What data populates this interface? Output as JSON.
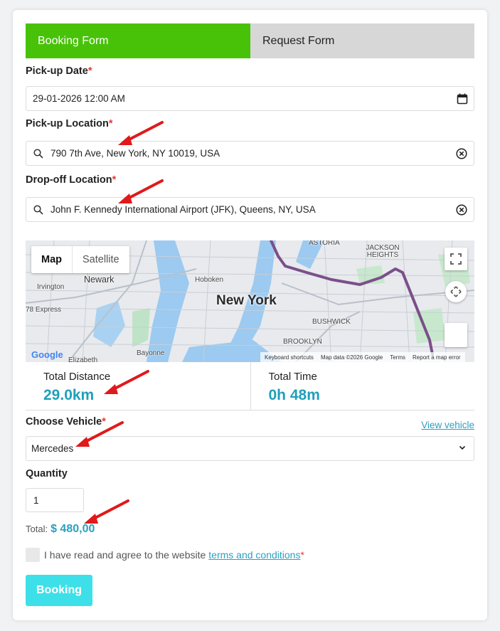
{
  "tabs": [
    {
      "label": "Booking Form",
      "active": true
    },
    {
      "label": "Request Form",
      "active": false
    }
  ],
  "pickup_date": {
    "label": "Pick-up Date",
    "required": "*",
    "value": "29-01-2026 12:00 AM",
    "icon": "calendar-icon"
  },
  "pickup_location": {
    "label": "Pick-up Location",
    "required": "*",
    "value": "790 7th Ave, New York, NY 10019, USA",
    "icons": [
      "search-icon",
      "clear-icon"
    ]
  },
  "dropoff_location": {
    "label": "Drop-off Location",
    "required": "*",
    "value": "John F. Kennedy International Airport (JFK), Queens, NY, USA",
    "icons": [
      "search-icon",
      "clear-icon"
    ]
  },
  "map": {
    "toggle": {
      "map": "Map",
      "satellite": "Satellite"
    },
    "city": "New York",
    "places": {
      "newark": "Newark",
      "hoboken": "Hoboken",
      "irvington": "Irvington",
      "bayonne": "Bayonne",
      "elizabeth": "Elizabeth",
      "brooklyn": "BROOKLYN",
      "bushwick": "BUSHWICK",
      "astoria": "ASTORIA",
      "jackson_heights": "JACKSON HEIGHTS",
      "express": "78 Express"
    },
    "footer": {
      "shortcuts": "Keyboard shortcuts",
      "data": "Map data ©2026 Google",
      "terms": "Terms",
      "report": "Report a map error"
    },
    "logo": "Google",
    "route_color": "#7b4f8a"
  },
  "total_distance": {
    "label": "Total Distance",
    "value": "29.0km"
  },
  "total_time": {
    "label": "Total Time",
    "value": "0h 48m"
  },
  "vehicle": {
    "label": "Choose Vehicle",
    "required": "*",
    "link": "View vehicle",
    "value": "Mercedes"
  },
  "quantity": {
    "label": "Quantity",
    "value": "1"
  },
  "total": {
    "label": "Total:",
    "value": "$ 480,00"
  },
  "agree": {
    "text": "I have read and agree to the website",
    "link": "terms and conditions",
    "required": "*"
  },
  "submit": {
    "label": "Booking"
  },
  "colors": {
    "tab_active": "#48c209",
    "accent": "#1f9fbb",
    "button": "#3de0e8",
    "arrow": "#e0191b"
  }
}
